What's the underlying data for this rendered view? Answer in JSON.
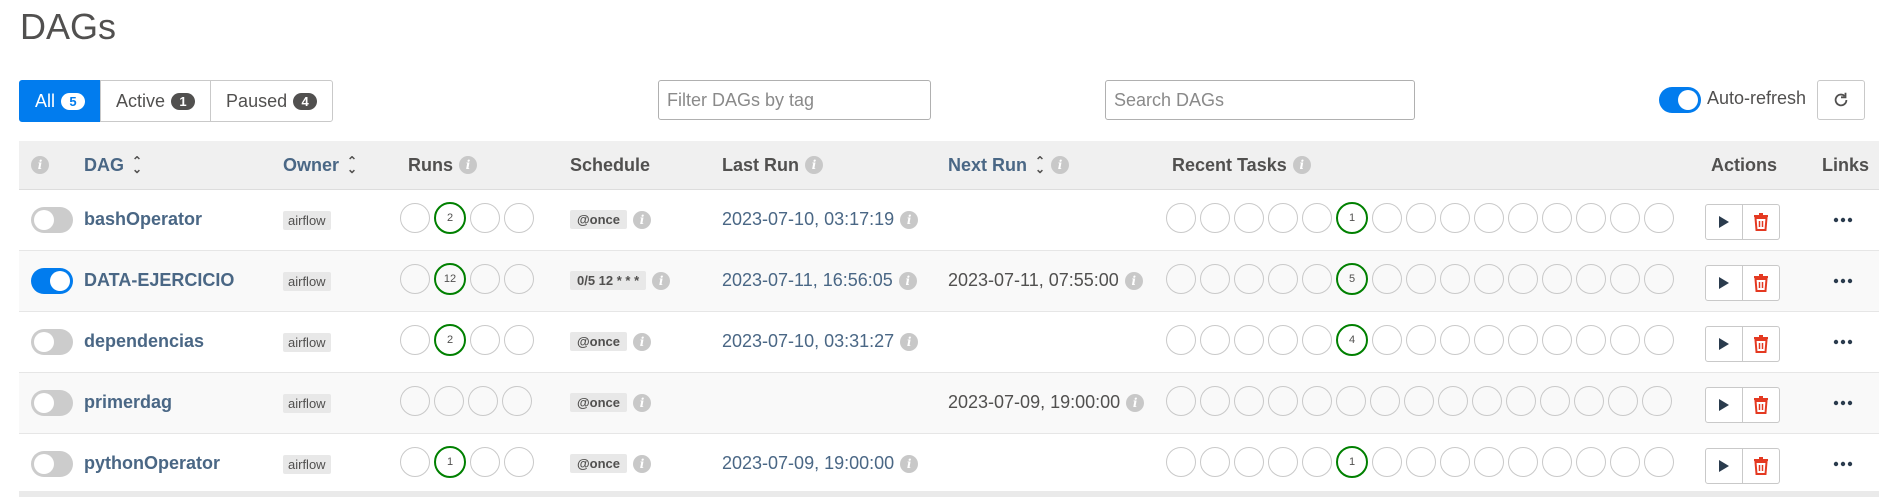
{
  "page": {
    "title": "DAGs"
  },
  "filters": {
    "tabs": [
      {
        "label": "All",
        "count": "5"
      },
      {
        "label": "Active",
        "count": "1"
      },
      {
        "label": "Paused",
        "count": "4"
      }
    ],
    "tag_placeholder": "Filter DAGs by tag",
    "search_placeholder": "Search DAGs",
    "auto_refresh_label": "Auto-refresh",
    "auto_refresh_on": true
  },
  "columns": {
    "dag": "DAG",
    "owner": "Owner",
    "runs": "Runs",
    "schedule": "Schedule",
    "last_run": "Last Run",
    "next_run": "Next Run",
    "recent_tasks": "Recent Tasks",
    "actions": "Actions",
    "links": "Links"
  },
  "icons": {
    "info": "i",
    "refresh": "refresh-icon",
    "trigger": "play-icon",
    "delete": "trash-icon",
    "more": "ellipsis-icon"
  },
  "colors": {
    "accent": "#017cee",
    "success": "#008000",
    "delete": "#e43921",
    "link": "#4a6785"
  },
  "dags": [
    {
      "name": "bashOperator",
      "active": false,
      "owner": "airflow",
      "runs": [
        "",
        "2",
        "",
        ""
      ],
      "schedule": "@once",
      "last_run": "2023-07-10, 03:17:19",
      "next_run": "",
      "tasks": [
        "",
        "",
        "",
        "",
        "",
        "1",
        "",
        "",
        "",
        "",
        "",
        "",
        "",
        "",
        ""
      ]
    },
    {
      "name": "DATA-EJERCICIO",
      "active": true,
      "owner": "airflow",
      "runs": [
        "",
        "12",
        "",
        ""
      ],
      "schedule": "0/5 12 * * *",
      "last_run": "2023-07-11, 16:56:05",
      "next_run": "2023-07-11, 07:55:00",
      "tasks": [
        "",
        "",
        "",
        "",
        "",
        "5",
        "",
        "",
        "",
        "",
        "",
        "",
        "",
        "",
        ""
      ]
    },
    {
      "name": "dependencias",
      "active": false,
      "owner": "airflow",
      "runs": [
        "",
        "2",
        "",
        ""
      ],
      "schedule": "@once",
      "last_run": "2023-07-10, 03:31:27",
      "next_run": "",
      "tasks": [
        "",
        "",
        "",
        "",
        "",
        "4",
        "",
        "",
        "",
        "",
        "",
        "",
        "",
        "",
        ""
      ]
    },
    {
      "name": "primerdag",
      "active": false,
      "owner": "airflow",
      "runs": [
        "",
        "",
        "",
        ""
      ],
      "schedule": "@once",
      "last_run": "",
      "next_run": "2023-07-09, 19:00:00",
      "tasks": [
        "",
        "",
        "",
        "",
        "",
        "",
        "",
        "",
        "",
        "",
        "",
        "",
        "",
        "",
        ""
      ]
    },
    {
      "name": "pythonOperator",
      "active": false,
      "owner": "airflow",
      "runs": [
        "",
        "1",
        "",
        ""
      ],
      "schedule": "@once",
      "last_run": "2023-07-09, 19:00:00",
      "next_run": "",
      "tasks": [
        "",
        "",
        "",
        "",
        "",
        "1",
        "",
        "",
        "",
        "",
        "",
        "",
        "",
        "",
        ""
      ]
    }
  ]
}
